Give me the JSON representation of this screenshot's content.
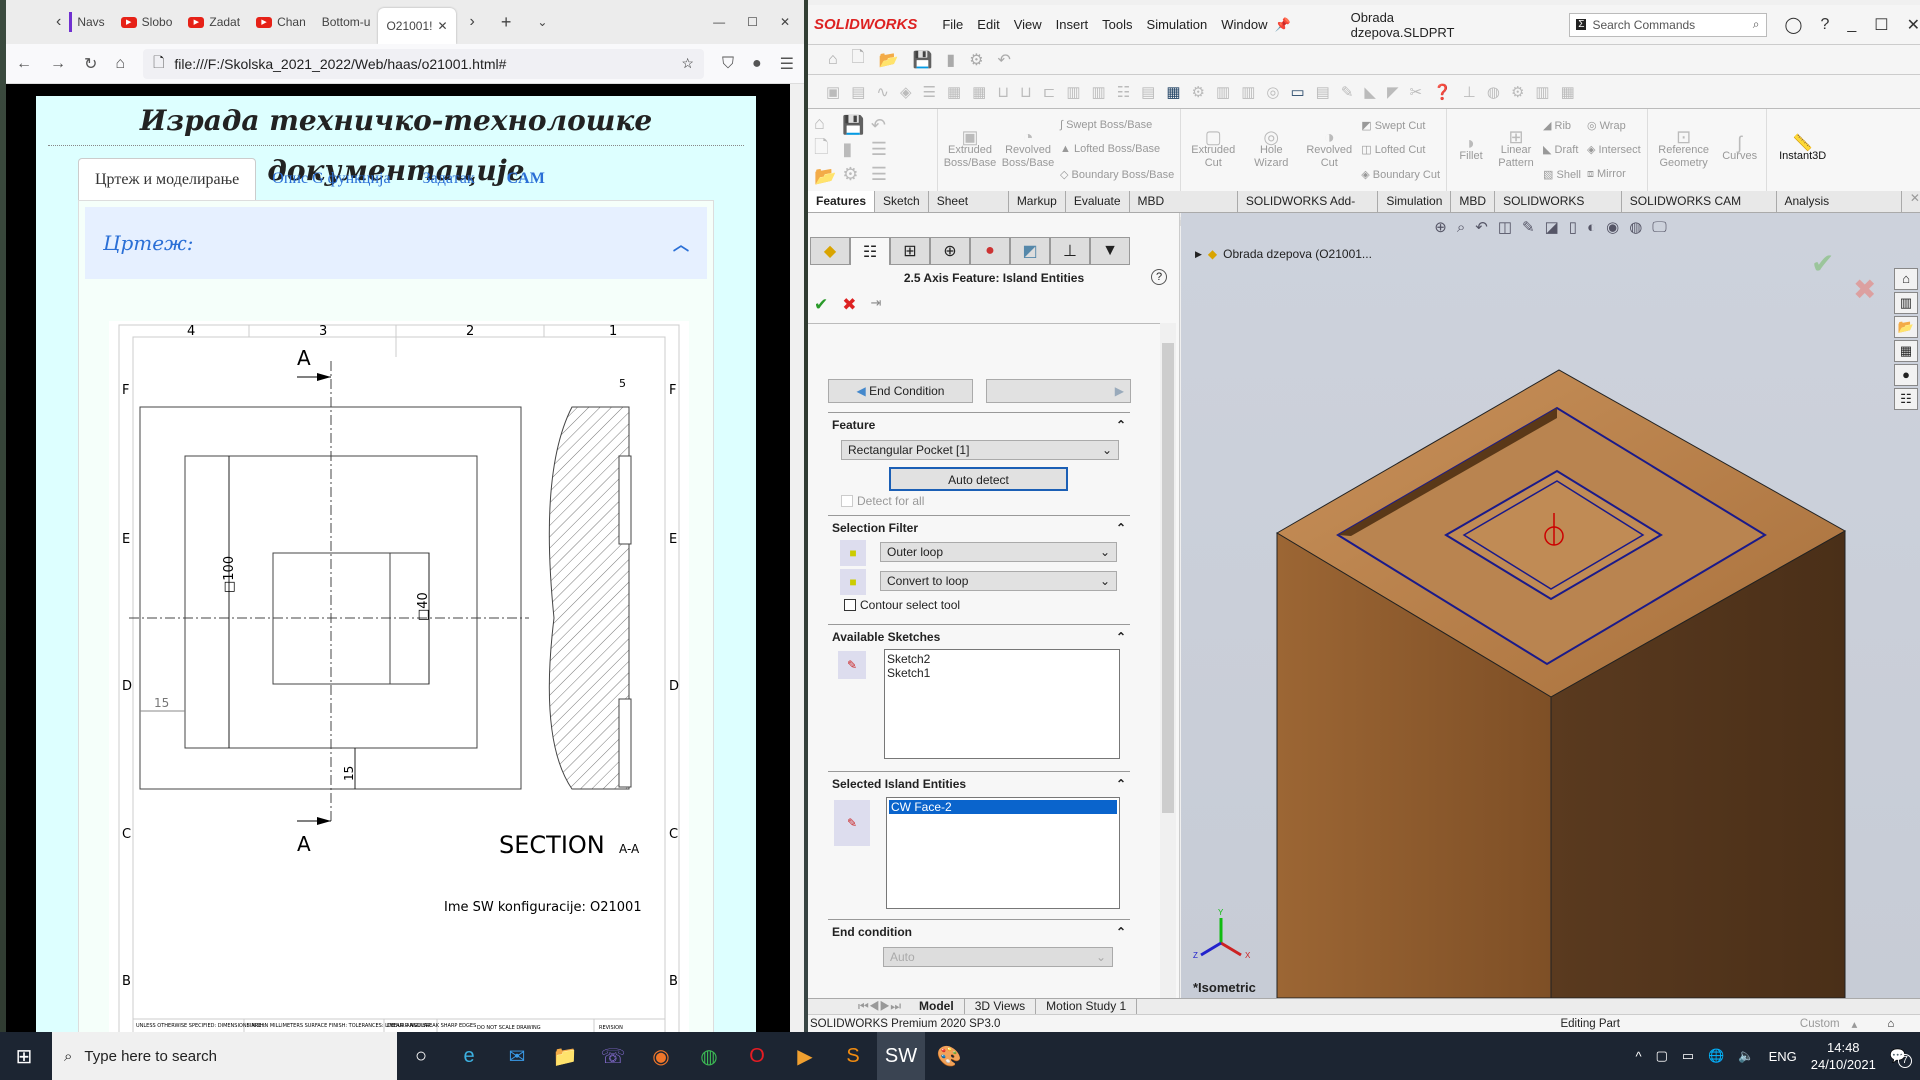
{
  "browser": {
    "tabs": [
      {
        "label": "Navs",
        "icon": "purple-bar"
      },
      {
        "label": "Slobo",
        "icon": "youtube-icon"
      },
      {
        "label": "Zadat",
        "icon": "youtube-icon"
      },
      {
        "label": "Chan",
        "icon": "youtube-icon"
      },
      {
        "label": "Bottom-u",
        "icon": ""
      },
      {
        "label": "O21001!",
        "icon": "",
        "active": true
      }
    ],
    "url": "file:///F:/Skolska_2021_2022/Web/haas/o21001.html#"
  },
  "page": {
    "title": "Израда техничко-технолошке документације",
    "tabs": [
      "Цртеж и моделирање",
      "Опис G функција",
      "Задатак",
      "CAM"
    ],
    "panel_title": "Цртеж:"
  },
  "drawing": {
    "columns": [
      "4",
      "3",
      "2",
      "1"
    ],
    "rows": [
      "F",
      "E",
      "D",
      "C",
      "B"
    ],
    "section_marker": "A",
    "dim_100": "□100",
    "dim_40": "□40",
    "dim_15_left": "15",
    "dim_15_bottom": "15",
    "dim_5": "5",
    "section_label": "SECTION",
    "section_sub": "A-A",
    "config_name": "Ime SW konfiguracije: O21001",
    "title_block": {
      "unless": "UNLESS OTHERWISE SPECIFIED: DIMENSIONS ARE IN MILLIMETERS SURFACE FINISH: TOLERANCES: LINEAR: ANGULAR:",
      "finish": "FINISH:",
      "deburr": "DEBURR AND BREAK SHARP EDGES",
      "no_scale": "DO NOT SCALE DRAWING",
      "revision": "REVISION"
    }
  },
  "solidworks": {
    "brand": "SOLIDWORKS",
    "menu": [
      "File",
      "Edit",
      "View",
      "Insert",
      "Tools",
      "Simulation",
      "Window"
    ],
    "document": "Obrada dzepova.SLDPRT",
    "search_placeholder": "Search Commands",
    "ribbon": {
      "extruded_boss": "Extruded Boss/Base",
      "revolved_boss": "Revolved Boss/Base",
      "swept_boss": "Swept Boss/Base",
      "lofted_boss": "Lofted Boss/Base",
      "boundary_boss": "Boundary Boss/Base",
      "extruded_cut": "Extruded Cut",
      "hole_wizard": "Hole Wizard",
      "revolved_cut": "Revolved Cut",
      "swept_cut": "Swept Cut",
      "lofted_cut": "Lofted Cut",
      "boundary_cut": "Boundary Cut",
      "fillet": "Fillet",
      "linear_pattern": "Linear Pattern",
      "rib": "Rib",
      "draft": "Draft",
      "shell": "Shell",
      "wrap": "Wrap",
      "intersect": "Intersect",
      "mirror": "Mirror",
      "reference_geometry": "Reference Geometry",
      "curves": "Curves",
      "instant3d": "Instant3D"
    },
    "command_tabs": [
      "Features",
      "Sketch",
      "Sheet Metal",
      "Markup",
      "Evaluate",
      "MBD Dimensions",
      "SOLIDWORKS Add-Ins",
      "Simulation",
      "MBD",
      "SOLIDWORKS CAM",
      "SOLIDWORKS CAM TBM",
      "Analysis Preparation"
    ],
    "pm": {
      "title": "2.5 Axis Feature: Island Entities",
      "end_condition_btn": "End Condition",
      "feature_header": "Feature",
      "feature_value": "Rectangular Pocket [1]",
      "auto_detect": "Auto detect",
      "detect_all": "Detect for all",
      "selection_filter_header": "Selection Filter",
      "filter1": "Outer loop",
      "filter2": "Convert to loop",
      "contour_tool": "Contour select tool",
      "available_sketches_header": "Available Sketches",
      "sketches": [
        "Sketch2",
        "Sketch1"
      ],
      "selected_islands_header": "Selected Island Entities",
      "islands": [
        "CW Face-2"
      ],
      "end_condition_header": "End condition",
      "end_condition_value": "Auto"
    },
    "tree_root": "Obrada dzepova  (O21001...",
    "view_label": "*Isometric",
    "bottom_tabs": [
      "Model",
      "3D Views",
      "Motion Study 1"
    ],
    "status_left": "SOLIDWORKS Premium 2020 SP3.0",
    "status_mid": "Editing Part",
    "status_units": "Custom"
  },
  "taskbar": {
    "search_placeholder": "Type here to search",
    "lang": "ENG",
    "time": "14:48",
    "date": "24/10/2021",
    "notifications": "7"
  }
}
